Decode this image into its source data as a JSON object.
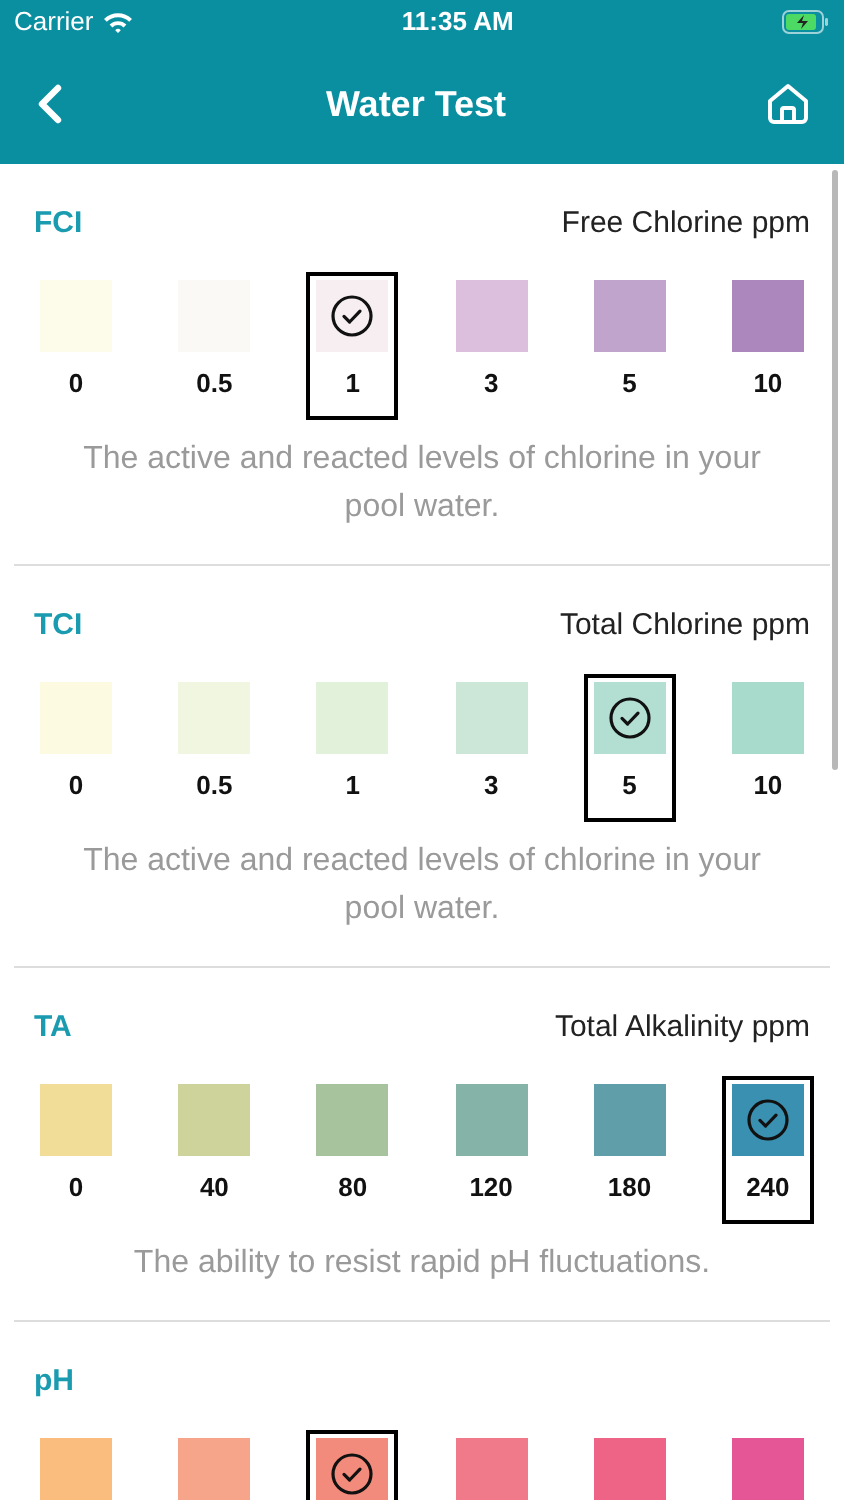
{
  "status_bar": {
    "carrier": "Carrier",
    "time": "11:35 AM"
  },
  "header": {
    "title": "Water Test"
  },
  "tests": [
    {
      "code": "FCI",
      "title": "Free Chlorine ppm",
      "description": "The active and reacted levels of chlorine in your pool water.",
      "options": [
        {
          "value": "0",
          "color": "#fdfbe9",
          "selected": false
        },
        {
          "value": "0.5",
          "color": "#fbf9f6",
          "selected": false
        },
        {
          "value": "1",
          "color": "#f6eef0",
          "selected": true
        },
        {
          "value": "3",
          "color": "#dbbfdc",
          "selected": false
        },
        {
          "value": "5",
          "color": "#c1a4cc",
          "selected": false
        },
        {
          "value": "10",
          "color": "#ab87bd",
          "selected": false
        }
      ]
    },
    {
      "code": "TCI",
      "title": "Total Chlorine ppm",
      "description": "The active and reacted levels of chlorine in your pool water.",
      "options": [
        {
          "value": "0",
          "color": "#fcfbe2",
          "selected": false
        },
        {
          "value": "0.5",
          "color": "#f0f6df",
          "selected": false
        },
        {
          "value": "1",
          "color": "#e2f1da",
          "selected": false
        },
        {
          "value": "3",
          "color": "#cce7d7",
          "selected": false
        },
        {
          "value": "5",
          "color": "#b2dfd2",
          "selected": true
        },
        {
          "value": "10",
          "color": "#a9dbcd",
          "selected": false
        }
      ]
    },
    {
      "code": "TA",
      "title": "Total Alkalinity ppm",
      "description": "The ability to resist rapid pH fluctuations.",
      "options": [
        {
          "value": "0",
          "color": "#f1dc98",
          "selected": false
        },
        {
          "value": "40",
          "color": "#cdd39b",
          "selected": false
        },
        {
          "value": "80",
          "color": "#a6c39d",
          "selected": false
        },
        {
          "value": "120",
          "color": "#86b3a8",
          "selected": false
        },
        {
          "value": "180",
          "color": "#609faa",
          "selected": false
        },
        {
          "value": "240",
          "color": "#3990b0",
          "selected": true
        }
      ]
    },
    {
      "code": "pH",
      "options": [
        {
          "color": "#fbbd7e",
          "selected": false
        },
        {
          "color": "#f7a58a",
          "selected": false
        },
        {
          "color": "#f38b7c",
          "selected": true
        },
        {
          "color": "#f07a89",
          "selected": false
        },
        {
          "color": "#ee6486",
          "selected": false
        },
        {
          "color": "#e45695",
          "selected": false
        }
      ]
    }
  ]
}
